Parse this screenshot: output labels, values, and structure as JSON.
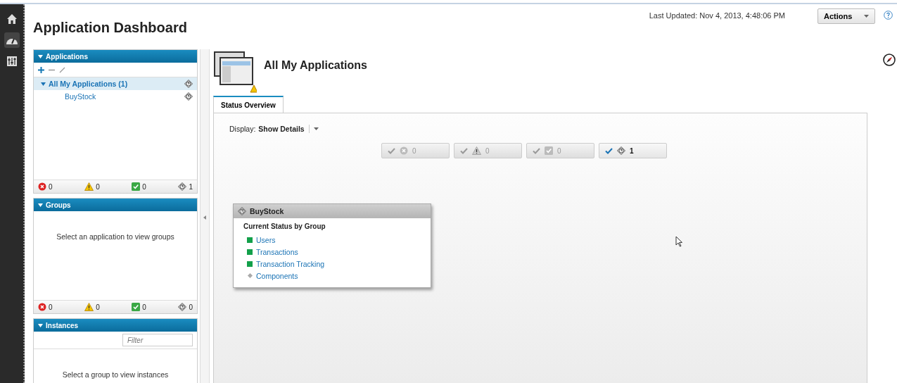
{
  "nav": [
    {
      "kind": "home",
      "selected": false
    },
    {
      "kind": "gauge",
      "selected": true
    },
    {
      "kind": "sliders",
      "selected": false
    }
  ],
  "header": {
    "title": "Application Dashboard",
    "last_updated": "Last Updated: Nov 4, 2013, 4:48:06 PM",
    "actions": "Actions"
  },
  "applications": {
    "title": "Applications",
    "expanded": true,
    "tree": [
      {
        "label": "All My Applications (1)",
        "selected": true,
        "expanded": true,
        "children": [
          {
            "label": "BuyStock",
            "selected": false
          }
        ]
      }
    ],
    "counts": [
      {
        "kind": "error",
        "count": "0"
      },
      {
        "kind": "warning",
        "count": "0"
      },
      {
        "kind": "ok",
        "count": "0"
      },
      {
        "kind": "unknown",
        "count": "1"
      }
    ]
  },
  "groups": {
    "title": "Groups",
    "expanded": true,
    "message": "Select an application to view groups",
    "counts": [
      {
        "kind": "error",
        "count": "0"
      },
      {
        "kind": "warning",
        "count": "0"
      },
      {
        "kind": "ok",
        "count": "0"
      },
      {
        "kind": "unknown",
        "count": "0"
      }
    ]
  },
  "instances": {
    "title": "Instances",
    "expanded": true,
    "filter": {
      "placeholder": "Filter"
    },
    "message": "Select a group to view instances"
  },
  "main": {
    "title": "All My Applications",
    "tabs": [
      {
        "label": "Status Overview",
        "selected": true
      }
    ],
    "display_label": "Display:",
    "display_value": "Show Details",
    "filters": [
      {
        "kind": "error",
        "count": "0",
        "checked": false
      },
      {
        "kind": "warning",
        "count": "0",
        "checked": false
      },
      {
        "kind": "ok",
        "count": "0",
        "checked": false
      },
      {
        "kind": "unknown",
        "count": "1",
        "checked": true
      }
    ],
    "card": {
      "title": "BuyStock",
      "subtitle": "Current Status by Group",
      "groups": [
        {
          "label": "Users",
          "kind": "ok"
        },
        {
          "label": "Transactions",
          "kind": "ok"
        },
        {
          "label": "Transaction Tracking",
          "kind": "ok"
        },
        {
          "label": "Components",
          "kind": "none"
        }
      ]
    }
  }
}
